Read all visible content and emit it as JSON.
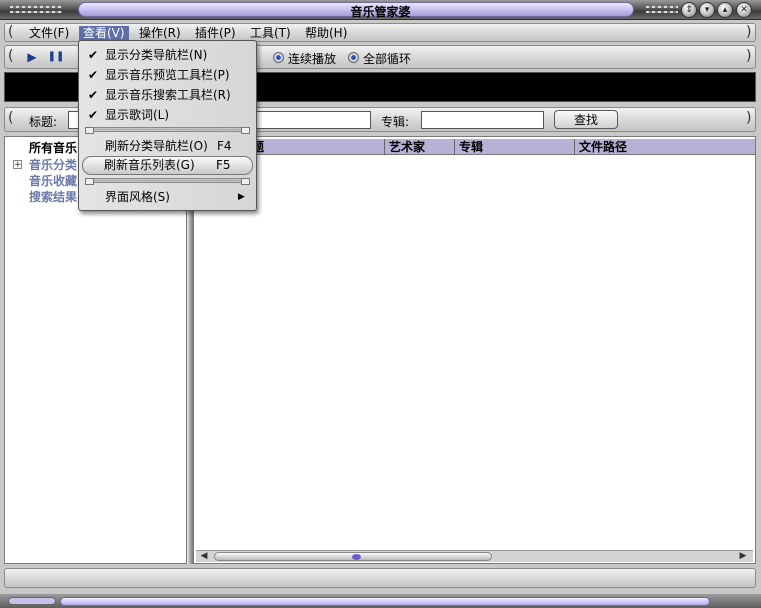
{
  "window": {
    "title": "音乐管家婆"
  },
  "menubar": {
    "items": [
      {
        "label": "文件(F)"
      },
      {
        "label": "查看(V)"
      },
      {
        "label": "操作(R)"
      },
      {
        "label": "插件(P)"
      },
      {
        "label": "工具(T)"
      },
      {
        "label": "帮助(H)"
      }
    ]
  },
  "toolbar": {
    "play_icon": "▶",
    "pause_icon": "❚❚",
    "continuous_label": "连续播放",
    "loop_label": "全部循环"
  },
  "search": {
    "title_label": "标题:",
    "title_value": "",
    "album_label": "专辑:",
    "album_value": "",
    "button_label": "查找"
  },
  "tree": {
    "items": [
      {
        "label": "所有音乐"
      },
      {
        "label": "音乐分类"
      },
      {
        "label": "音乐收藏"
      },
      {
        "label": "搜索结果"
      }
    ]
  },
  "list": {
    "columns": [
      "题",
      "艺术家",
      "专辑",
      "文件路径"
    ]
  },
  "view_menu": {
    "items": [
      {
        "label": "显示分类导航栏(N)",
        "checked": true,
        "check": "✔"
      },
      {
        "label": "显示音乐预览工具栏(P)",
        "checked": true,
        "check": "✔"
      },
      {
        "label": "显示音乐搜索工具栏(R)",
        "checked": true,
        "check": "✔"
      },
      {
        "label": "显示歌词(L)",
        "checked": true,
        "check": "✔"
      },
      {
        "label": "刷新分类导航栏(O)",
        "shortcut": "F4"
      },
      {
        "label": "刷新音乐列表(G)",
        "shortcut": "F5",
        "highlighted": true
      },
      {
        "label": "界面风格(S)",
        "submenu_arrow": "▶"
      }
    ]
  },
  "colors": {
    "menu_active": "#5d6ea8",
    "header_bg": "#b6b2d6",
    "accent": "#2d4fb3"
  }
}
